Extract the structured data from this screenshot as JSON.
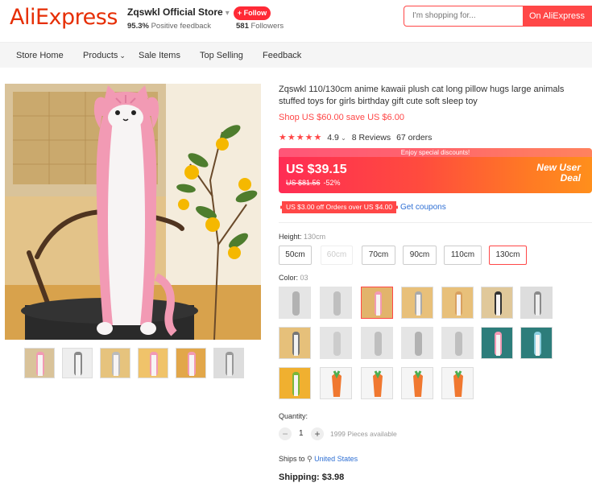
{
  "header": {
    "logo": "AliExpress",
    "store_name": "Zqswkl Official Store",
    "positive_pct": "95.3%",
    "positive_text": "Positive feedback",
    "follow_label": "+ Follow",
    "followers_count": "581",
    "followers_text": "Followers",
    "search_placeholder": "I'm shopping for...",
    "search_button": "On AliExpress"
  },
  "nav": [
    "Store Home",
    "Products",
    "Sale Items",
    "Top Selling",
    "Feedback"
  ],
  "product": {
    "title": "Zqswkl 110/130cm anime kawaii plush cat long pillow hugs large animals stuffed toys for girls birthday gift cute soft sleep toy",
    "shop_line": "Shop US $60.00 save US $6.00",
    "stars": "★★★★★",
    "rating": "4.9",
    "reviews": "8 Reviews",
    "orders": "67 orders",
    "promo_banner": "Enjoy special discounts!",
    "price": "US $39.15",
    "old_price": "US $81.56",
    "discount": "-52%",
    "deal_line1": "New User",
    "deal_line2": "Deal",
    "coupon": "US $3.00 off Orders over US $4.00",
    "get_coupons": "Get coupons"
  },
  "height": {
    "label": "Height:",
    "value": "130cm",
    "options": [
      "50cm",
      "60cm",
      "70cm",
      "90cm",
      "110cm",
      "130cm"
    ]
  },
  "color": {
    "label": "Color:",
    "value": "03"
  },
  "quantity": {
    "label": "Quantity:",
    "value": "1",
    "minus": "−",
    "plus": "+",
    "available": "1999 Pieces available"
  },
  "shipping": {
    "ships_to_label": "Ships to",
    "ships_to": "United States",
    "shipping_label": "Shipping: $3.98"
  },
  "colors": {
    "accent": "#ff4747",
    "link": "#2e6fd4",
    "pink": "#f29ab4"
  }
}
